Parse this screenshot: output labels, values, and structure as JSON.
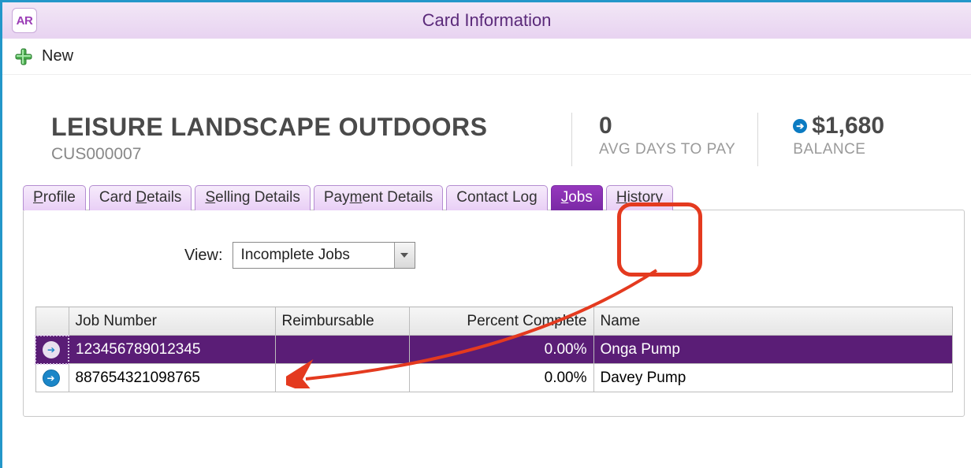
{
  "window": {
    "icon_text": "AR",
    "title": "Card Information"
  },
  "toolbar": {
    "new_label": "New"
  },
  "summary": {
    "company_name": "LEISURE LANDSCAPE OUTDOORS",
    "company_code": "CUS000007",
    "avg_days_value": "0",
    "avg_days_label": "AVG DAYS TO PAY",
    "balance_value": "$1,680",
    "balance_label": "BALANCE"
  },
  "tabs": {
    "profile": "Profile",
    "card_details": "Card Details",
    "selling_details": "Selling Details",
    "payment_details": "Payment Details",
    "contact_log": "Contact Log",
    "jobs": "Jobs",
    "history": "History"
  },
  "view": {
    "label": "View:",
    "selected": "Incomplete Jobs"
  },
  "table": {
    "headers": {
      "job_number": "Job Number",
      "reimbursable": "Reimbursable",
      "percent_complete": "Percent Complete",
      "name": "Name"
    },
    "rows": [
      {
        "job_number": "123456789012345",
        "reimbursable": "",
        "percent_complete": "0.00%",
        "name": "Onga Pump"
      },
      {
        "job_number": "887654321098765",
        "reimbursable": "",
        "percent_complete": "0.00%",
        "name": "Davey Pump"
      }
    ]
  }
}
